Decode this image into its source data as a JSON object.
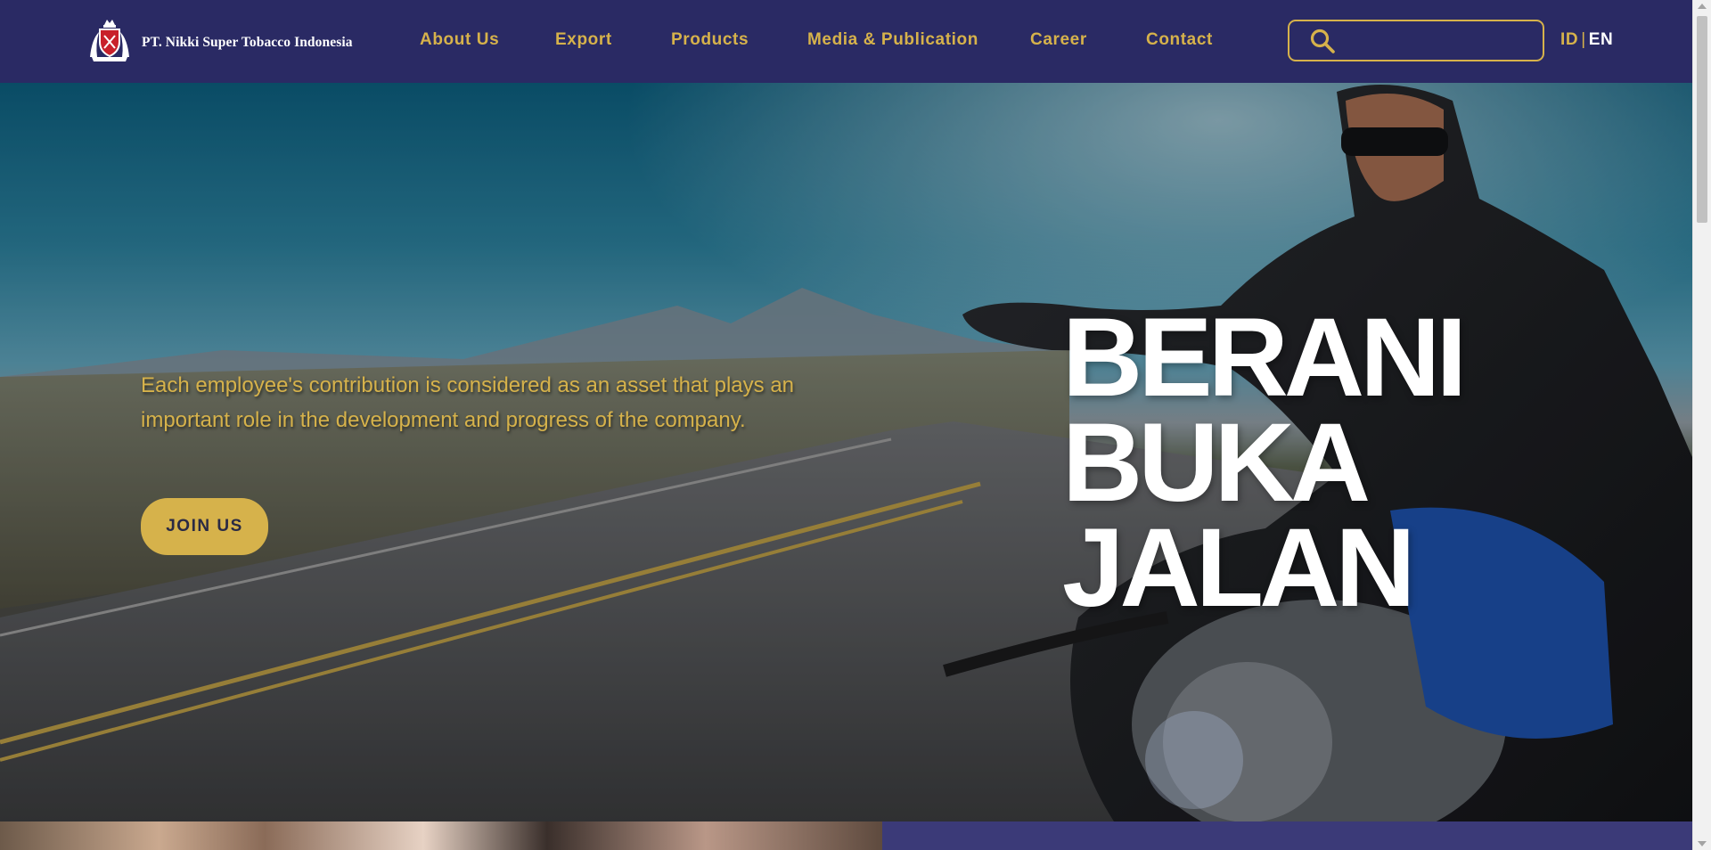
{
  "header": {
    "brand_name": "PT. Nikki Super Tobacco Indonesia",
    "logo_icon": "royal-crest-logo",
    "nav": {
      "about": "About Us",
      "export": "Export",
      "products": "Products",
      "media": "Media & Publication",
      "career": "Career",
      "contact": "Contact"
    },
    "search": {
      "icon": "search-icon",
      "placeholder": ""
    },
    "lang": {
      "id": "ID",
      "separator": "|",
      "en": "EN"
    }
  },
  "hero": {
    "description": "Each employee's contribution is considered as an asset that plays an important role in the development and progress of the company.",
    "button_label": "JOIN US",
    "slogan": [
      "BERANI",
      "BUKA",
      "JALAN"
    ]
  },
  "colors": {
    "navbar": "#2a2a64",
    "accent_gold": "#d6b24b",
    "white": "#ffffff",
    "bottom_panel": "#3b3a78"
  }
}
